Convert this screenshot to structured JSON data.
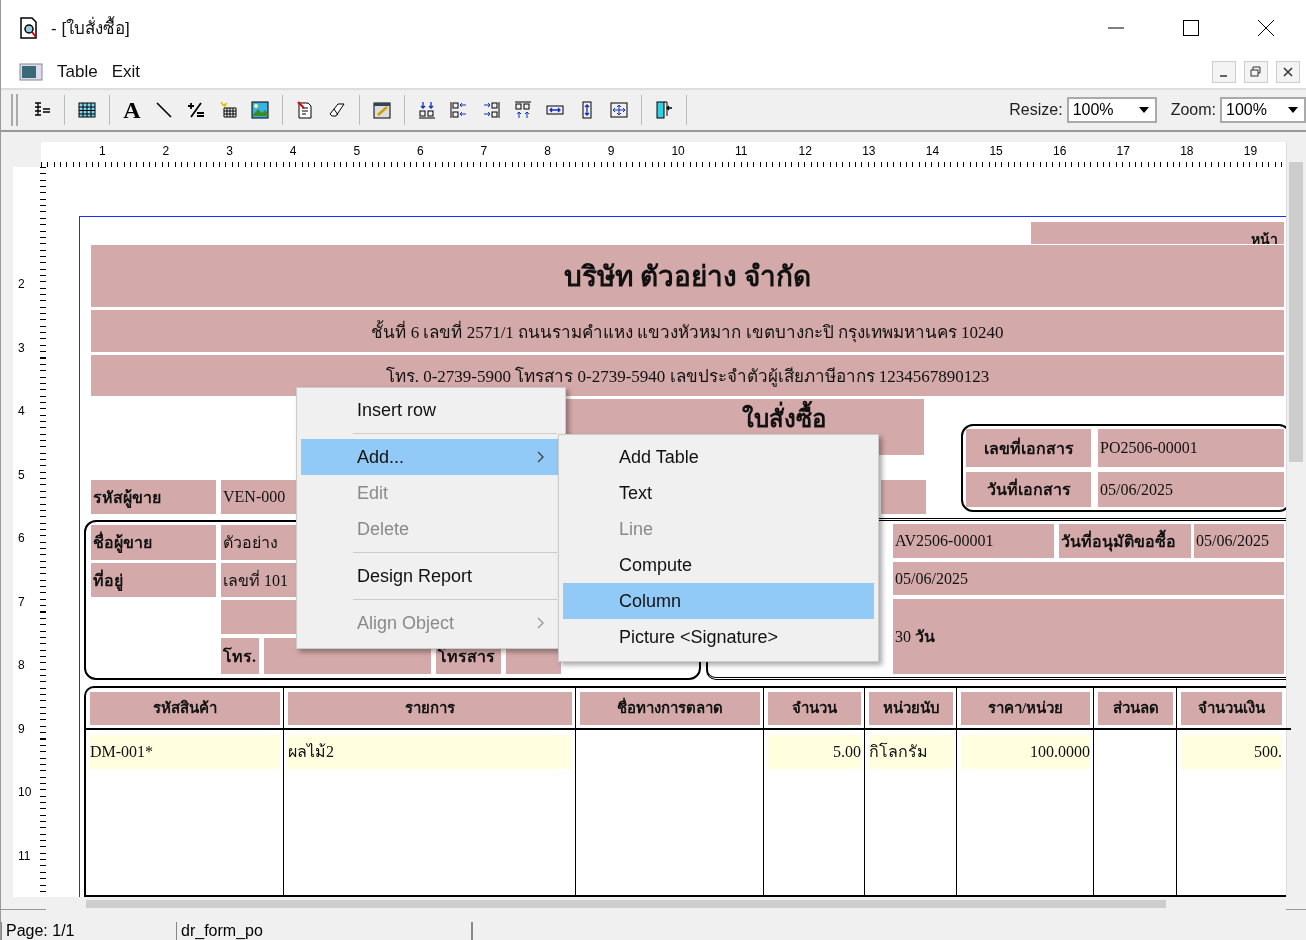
{
  "window": {
    "title": "- [ใบสั่งซื้อ]"
  },
  "menu": [
    {
      "label": "Table"
    },
    {
      "label": "Exit"
    }
  ],
  "toolbar": {
    "text_tool_glyph": "A",
    "resize": {
      "label": "Resize:",
      "value": "100%"
    },
    "zoom": {
      "label": "Zoom:",
      "value": "100%"
    }
  },
  "ruler": {
    "horizontal": [
      "1",
      "2",
      "3",
      "4",
      "5",
      "6",
      "7",
      "8",
      "9",
      "10",
      "11",
      "12",
      "13",
      "14",
      "15",
      "16",
      "17",
      "18",
      "19"
    ],
    "vertical": [
      "2",
      "3",
      "4",
      "5",
      "6",
      "7",
      "8",
      "9",
      "10",
      "11"
    ]
  },
  "report": {
    "cells": [
      {
        "text": "หน้า",
        "kind": "corner"
      },
      {
        "text": "บริษัท ตัวอย่าง จำกัด",
        "kind": "title"
      },
      {
        "text": "ชั้นที่ 6 เลขที่ 2571/1 ถนนรามคำแหง แขวงหัวหมาก เขตบางกะปิ กรุงเทพมหานคร 10240",
        "kind": "line"
      },
      {
        "text": "โทร. 0-2739-5900  โทรสาร 0-2739-5940  เลขประจำตัวผู้เสียภาษีอากร 1234567890123",
        "kind": "line"
      },
      {
        "text": "ใบสั่งซื้อ",
        "kind": "heading"
      },
      {
        "text": "เลขที่เอกสาร",
        "kind": "label"
      },
      {
        "text": "PO2506-00001",
        "kind": "value"
      },
      {
        "text": "รหัสผู้ขาย",
        "kind": "label"
      },
      {
        "text": "VEN-000",
        "kind": "value"
      },
      {
        "text": "วันที่เอกสาร",
        "kind": "label"
      },
      {
        "text": "05/06/2025",
        "kind": "value"
      },
      {
        "text": "ชื่อผู้ขาย",
        "kind": "label"
      },
      {
        "text": "ตัวอย่าง",
        "kind": "value"
      },
      {
        "text": "AV2506-00001",
        "kind": "value"
      },
      {
        "text": "วันที่อนุมัติขอซื้อ",
        "kind": "label"
      },
      {
        "text": "05/06/2025",
        "kind": "value"
      },
      {
        "text": "ที่อยู่",
        "kind": "label"
      },
      {
        "text": "เลขที่ 101",
        "kind": "value"
      },
      {
        "text": "05/06/2025",
        "kind": "value"
      },
      {
        "text": "30  **วัน**",
        "kind": "value"
      },
      {
        "text": "โทร.",
        "kind": "label"
      },
      {
        "text": "โทรสาร",
        "kind": "label"
      }
    ],
    "table": {
      "columns": [
        "รหัสสินค้า",
        "รายการ",
        "ชื่อทางการตลาด",
        "จำนวน",
        "หน่วยนับ",
        "ราคา/หน่วย",
        "ส่วนลด",
        "จำนวนเงิน"
      ],
      "rows": [
        {
          "cells": [
            "DM-001*",
            "ผลไม้2",
            null,
            "5.00",
            "กิโลกรัม",
            "100.0000",
            null,
            "500."
          ]
        }
      ]
    }
  },
  "context_menu": {
    "items": [
      {
        "kind": "item",
        "label": "Insert row",
        "disabled": false,
        "selected": false,
        "submenu": false
      },
      {
        "kind": "separator"
      },
      {
        "kind": "item",
        "label": "Add...",
        "disabled": false,
        "selected": true,
        "submenu": true
      },
      {
        "kind": "item",
        "label": "Edit",
        "disabled": true,
        "selected": false,
        "submenu": false
      },
      {
        "kind": "item",
        "label": "Delete",
        "disabled": true,
        "selected": false,
        "submenu": false
      },
      {
        "kind": "separator"
      },
      {
        "kind": "item",
        "label": "Design Report",
        "disabled": false,
        "selected": false,
        "submenu": false
      },
      {
        "kind": "separator"
      },
      {
        "kind": "item",
        "label": "Align Object",
        "disabled": true,
        "selected": false,
        "submenu": true
      }
    ]
  },
  "submenu": {
    "items": [
      {
        "kind": "item",
        "label": "Add Table",
        "disabled": false,
        "selected": false,
        "submenu": false
      },
      {
        "kind": "item",
        "label": "Text",
        "disabled": false,
        "selected": false,
        "submenu": false
      },
      {
        "kind": "item",
        "label": "Line",
        "disabled": true,
        "selected": false,
        "submenu": false
      },
      {
        "kind": "item",
        "label": "Compute",
        "disabled": false,
        "selected": false,
        "submenu": false
      },
      {
        "kind": "item",
        "label": "Column",
        "disabled": false,
        "selected": true,
        "submenu": false
      },
      {
        "kind": "item",
        "label": "Picture <Signature>",
        "disabled": false,
        "selected": false,
        "submenu": false
      }
    ]
  },
  "status_bar": {
    "page": "Page: 1/1",
    "report": "dr_form_po"
  }
}
